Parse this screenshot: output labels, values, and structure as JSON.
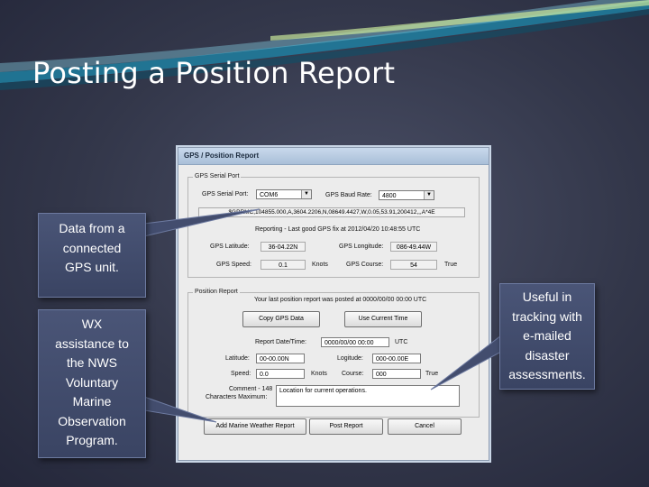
{
  "slide": {
    "title": "Posting a Position Report"
  },
  "dialog": {
    "title": "GPS / Position Report",
    "gps_serial_port_group": {
      "title": "GPS Serial Port",
      "port_label": "GPS Serial Port:",
      "port_value": "COM6",
      "baud_label": "GPS Baud Rate:",
      "baud_value": "4800",
      "nmea_sentence": "$GPRMC,104855.000,A,3604.2206,N,08649.4427,W,0.05,53.91,200412,,,A*4E",
      "status": "Reporting - Last good GPS fix at 2012/04/20 10:48:55 UTC",
      "latitude_label": "GPS Latitude:",
      "latitude_value": "36-04.22N",
      "longitude_label": "GPS Longitude:",
      "longitude_value": "086-49.44W",
      "speed_label": "GPS Speed:",
      "speed_value": "0.1",
      "speed_unit": "Knots",
      "course_label": "GPS Course:",
      "course_value": "54",
      "course_unit": "True"
    },
    "position_report_group": {
      "title": "Position Report",
      "last_report": "Your last position report was posted at 0000/00/00 00:00 UTC",
      "copy_gps_button": "Copy GPS Data",
      "use_current_time_button": "Use Current Time",
      "date_label": "Report Date/Time:",
      "date_value": "0000/00/00 00:00",
      "date_unit": "UTC",
      "latitude_label": "Latitude:",
      "latitude_value": "00-00.00N",
      "longitude_label": "Logitude:",
      "longitude_value": "000-00.00E",
      "speed_label": "Speed:",
      "speed_value": "0.0",
      "speed_unit": "Knots",
      "course_label": "Course:",
      "course_value": "000",
      "course_unit": "True",
      "comment_label_1": "Comment - 148",
      "comment_label_2": "Characters Maximum:",
      "comment_value": "Location for current operations."
    },
    "buttons": {
      "add_weather": "Add Marine Weather Report",
      "post_report": "Post Report",
      "cancel": "Cancel"
    }
  },
  "callouts": {
    "gps": [
      "Data from a",
      "connected",
      "GPS unit."
    ],
    "wx": [
      "WX",
      "assistance to",
      "the NWS",
      "Voluntary",
      "Marine",
      "Observation",
      "Program."
    ],
    "email": [
      "Useful in",
      "tracking with",
      "e-mailed",
      "disaster",
      "assessments."
    ]
  },
  "colors": {
    "background": "#33374a",
    "swoosh": "#1f7fa0",
    "callout_fill": "#434d6e",
    "dialog_title_bar": "#b9cce2"
  }
}
